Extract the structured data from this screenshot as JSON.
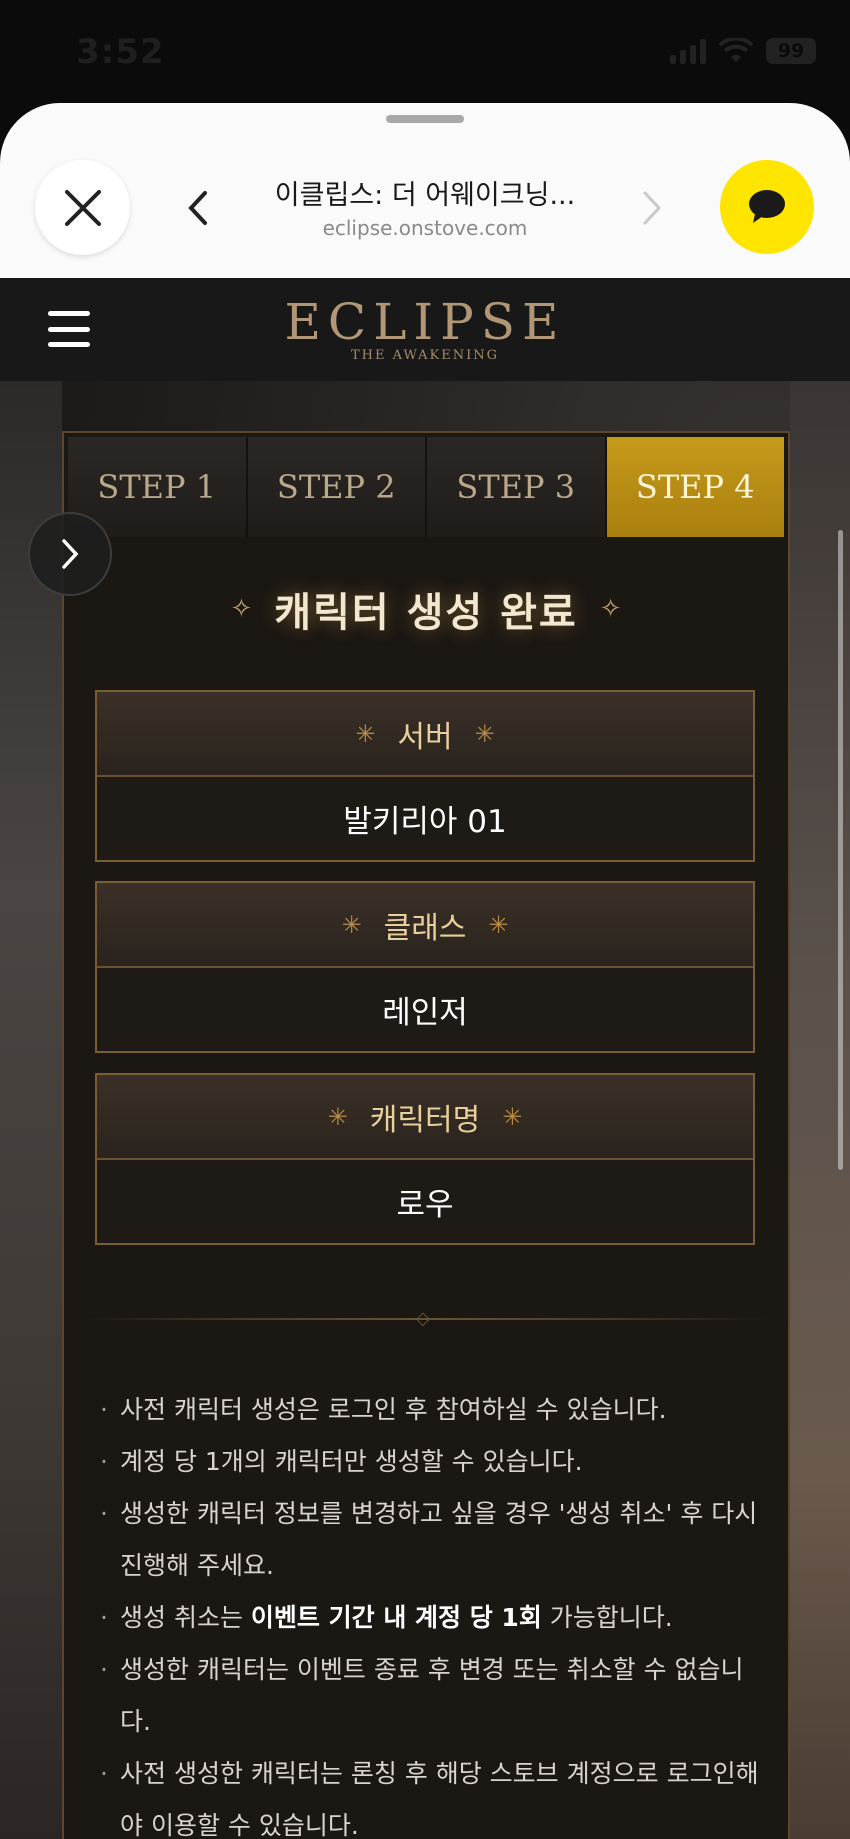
{
  "status": {
    "time": "3:52",
    "battery": "99"
  },
  "browser": {
    "title": "이클립스: 더 어웨이크닝...",
    "url": "eclipse.onstove.com"
  },
  "site": {
    "logo_main": "ECLIPSE",
    "logo_sub": "THE AWAKENING"
  },
  "tabs": [
    {
      "label": "STEP 1",
      "active": false
    },
    {
      "label": "STEP 2",
      "active": false
    },
    {
      "label": "STEP 3",
      "active": false
    },
    {
      "label": "STEP 4",
      "active": true
    }
  ],
  "heading": "캐릭터 생성 완료",
  "fields": [
    {
      "label": "서버",
      "value": "발키리아 01"
    },
    {
      "label": "클래스",
      "value": "레인저"
    },
    {
      "label": "캐릭터명",
      "value": "로우"
    }
  ],
  "notes": {
    "n1": "사전 캐릭터 생성은 로그인 후 참여하실 수 있습니다.",
    "n2": "계정 당 1개의 캐릭터만 생성할 수 있습니다.",
    "n3": "생성한 캐릭터 정보를 변경하고 싶을 경우 '생성 취소' 후 다시 진행해 주세요.",
    "n4_pre": "생성 취소는 ",
    "n4_bold": "이벤트 기간 내 계정 당 1회",
    "n4_post": " 가능합니다.",
    "n5": "생성한 캐릭터는 이벤트 종료 후 변경 또는 취소할 수 없습니다.",
    "n6": "사전 생성한 캐릭터는 론칭 후 해당 스토브 계정으로 로그인해야 이용할 수 있습니다."
  },
  "colors": {
    "accent": "#c69a1a",
    "talk": "#fee500"
  }
}
